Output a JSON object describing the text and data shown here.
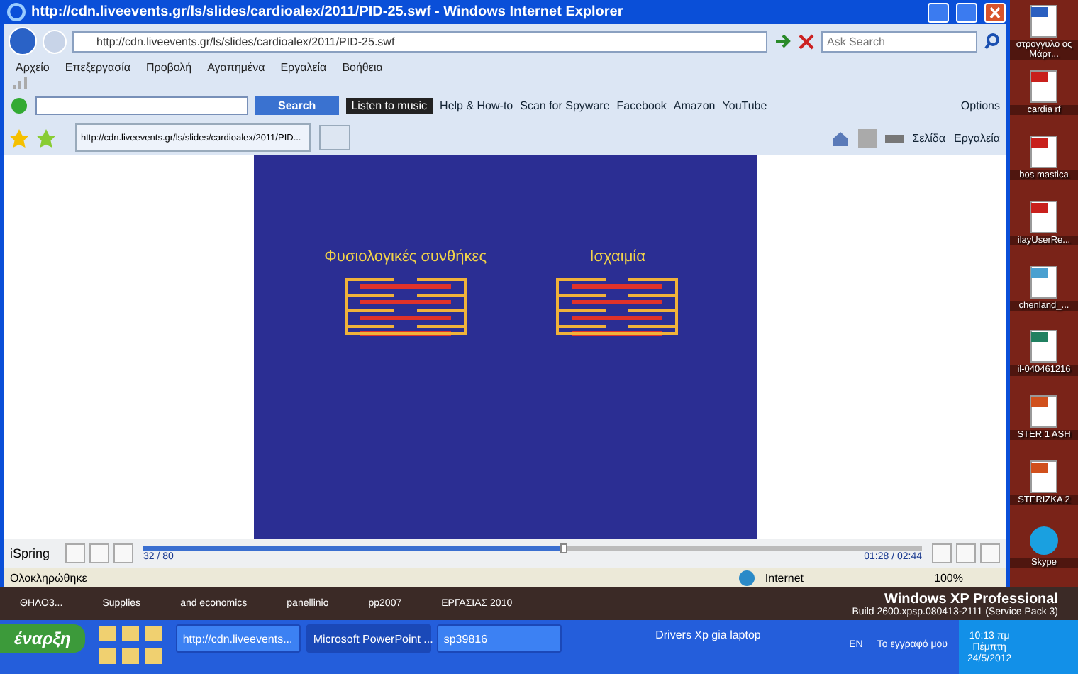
{
  "window": {
    "title": "http://cdn.liveevents.gr/ls/slides/cardioalex/2011/PID-25.swf - Windows Internet Explorer"
  },
  "address_bar": {
    "url": "http://cdn.liveevents.gr/ls/slides/cardioalex/2011/PID-25.swf",
    "search_placeholder": "Ask Search"
  },
  "menu": [
    "Αρχείο",
    "Επεξεργασία",
    "Προβολή",
    "Αγαπημένα",
    "Εργαλεία",
    "Βοήθεια"
  ],
  "ask_toolbar": {
    "search_button": "Search",
    "music_label": "Listen to music",
    "links": [
      "Help & How-to",
      "Scan for Spyware",
      "Facebook",
      "Amazon",
      "YouTube"
    ],
    "options": "Options"
  },
  "tab": {
    "title": "http://cdn.liveevents.gr/ls/slides/cardioalex/2011/PID..."
  },
  "command_bar": [
    "Σελίδα",
    "Εργαλεία"
  ],
  "slide": {
    "panels": [
      {
        "title": "Φυσιολογικές συνθήκες"
      },
      {
        "title": "Ισχαιμία"
      }
    ]
  },
  "player": {
    "brand": "iSpring",
    "slide_counter": "32 / 80",
    "time": "01:28 / 02:44",
    "level": 0.54
  },
  "status_bar": {
    "text": "Ολοκληρώθηκε",
    "zone": "Internet",
    "zoom": "100%"
  },
  "desktop": {
    "icons": [
      {
        "label": "στρογγυλο ος Μάρτ...",
        "kind": "doc"
      },
      {
        "label": "cardia rf",
        "kind": "pdf"
      },
      {
        "label": "bos mastica",
        "kind": "pdf"
      },
      {
        "label": "ilayUserRe...",
        "kind": "pdf"
      },
      {
        "label": "chenland_...",
        "kind": "image"
      },
      {
        "label": "il-040461216",
        "kind": "file"
      },
      {
        "label": "STER 1 ASH",
        "kind": "ppt"
      },
      {
        "label": "STERIZKA 2",
        "kind": "ppt"
      },
      {
        "label": "Skype",
        "kind": "skype"
      }
    ],
    "wallpaper_labels": [
      "ΘΗΛΟ3...",
      "Supplies",
      "and economics",
      "panellinio",
      "pp2007",
      "ΕΡΓΑΣΙΑΣ 2010"
    ],
    "os_info": [
      "Windows XP Professional",
      "Build 2600.xpsp.080413-2111 (Service Pack 3)"
    ]
  },
  "taskbar": {
    "start": "έναρξη",
    "buttons": [
      {
        "label": "http://cdn.liveevents...",
        "selected": false
      },
      {
        "label": "Microsoft PowerPoint ...",
        "selected": true
      },
      {
        "label": "sp39816",
        "selected": false
      }
    ],
    "folder_label": "Drivers Xp gia laptop",
    "language": "EN",
    "my_documents": "Το εγγραφό μου",
    "clock": [
      "10:13 πμ",
      "Πέμπτη",
      "24/5/2012"
    ]
  }
}
